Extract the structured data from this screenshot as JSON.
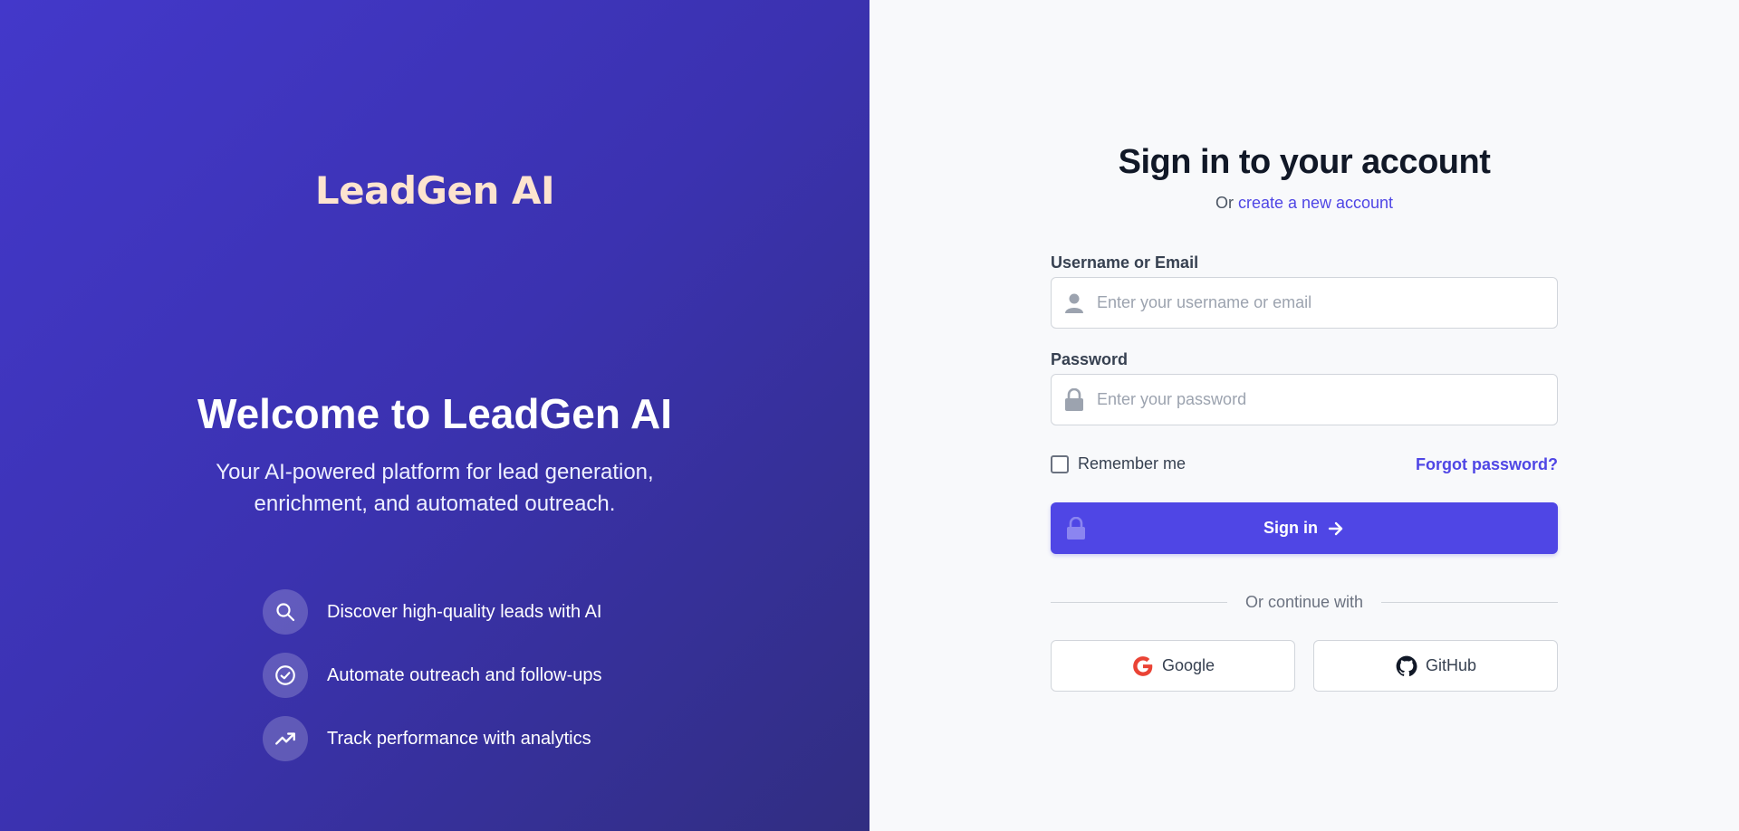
{
  "brand": {
    "logo": "LeadGen AI",
    "welcome_title": "Welcome to LeadGen AI",
    "subtitle": "Your AI-powered platform for lead generation, enrichment, and automated outreach."
  },
  "features": [
    {
      "icon": "search-icon",
      "text": "Discover high-quality leads with AI"
    },
    {
      "icon": "check-circle-icon",
      "text": "Automate outreach and follow-ups"
    },
    {
      "icon": "trending-up-icon",
      "text": "Track performance with analytics"
    }
  ],
  "form": {
    "title": "Sign in to your account",
    "alt_prefix": "Or",
    "alt_link": "create a new account",
    "username_label": "Username or Email",
    "username_placeholder": "Enter your username or email",
    "password_label": "Password",
    "password_placeholder": "Enter your password",
    "remember_label": "Remember me",
    "forgot_link": "Forgot password?",
    "submit_label": "Sign in",
    "divider_text": "Or continue with",
    "google_label": "Google",
    "github_label": "GitHub"
  },
  "colors": {
    "accent": "#4f46e5",
    "left_bg": "#4338ca",
    "logo": "#fde4cf"
  }
}
